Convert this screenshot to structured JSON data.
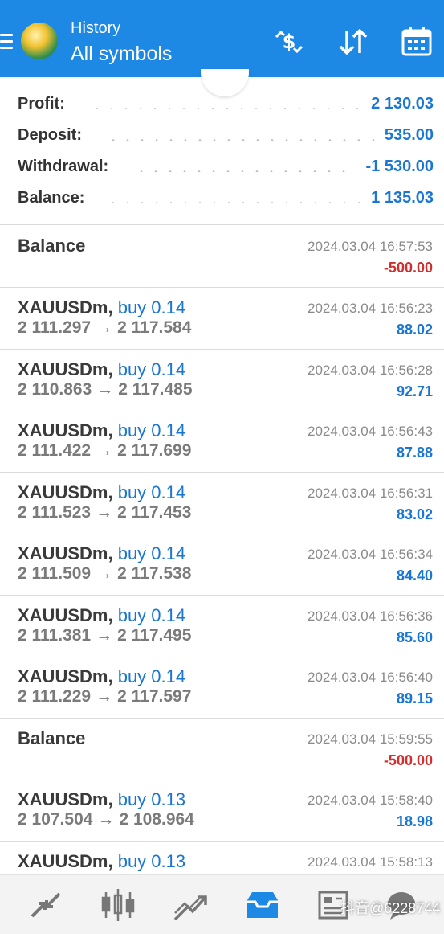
{
  "header": {
    "subtitle": "History",
    "title": "All symbols",
    "buttons": [
      "currency-switch-icon",
      "sort-icon",
      "calendar-icon"
    ]
  },
  "summary": {
    "profit": {
      "label": "Profit:",
      "value": "2 130.03"
    },
    "deposit": {
      "label": "Deposit:",
      "value": "535.00"
    },
    "withdrawal": {
      "label": "Withdrawal:",
      "value": "-1 530.00"
    },
    "balance": {
      "label": "Balance:",
      "value": "1 135.03"
    }
  },
  "deals": [
    {
      "kind": "balance",
      "title": "Balance",
      "time": "2024.03.04 16:57:53",
      "profit": "-500.00"
    },
    {
      "kind": "trade",
      "symbol": "XAUUSDm,",
      "side": "buy 0.14",
      "open": "2 111.297",
      "close": "2 117.584",
      "time": "2024.03.04 16:56:23",
      "profit": "88.02"
    },
    {
      "kind": "trade",
      "symbol": "XAUUSDm,",
      "side": "buy 0.14",
      "open": "2 110.863",
      "close": "2 117.485",
      "time": "2024.03.04 16:56:28",
      "profit": "92.71"
    },
    {
      "kind": "trade",
      "symbol": "XAUUSDm,",
      "side": "buy 0.14",
      "open": "2 111.422",
      "close": "2 117.699",
      "time": "2024.03.04 16:56:43",
      "profit": "87.88"
    },
    {
      "kind": "trade",
      "symbol": "XAUUSDm,",
      "side": "buy 0.14",
      "open": "2 111.523",
      "close": "2 117.453",
      "time": "2024.03.04 16:56:31",
      "profit": "83.02"
    },
    {
      "kind": "trade",
      "symbol": "XAUUSDm,",
      "side": "buy 0.14",
      "open": "2 111.509",
      "close": "2 117.538",
      "time": "2024.03.04 16:56:34",
      "profit": "84.40"
    },
    {
      "kind": "trade",
      "symbol": "XAUUSDm,",
      "side": "buy 0.14",
      "open": "2 111.381",
      "close": "2 117.495",
      "time": "2024.03.04 16:56:36",
      "profit": "85.60"
    },
    {
      "kind": "trade",
      "symbol": "XAUUSDm,",
      "side": "buy 0.14",
      "open": "2 111.229",
      "close": "2 117.597",
      "time": "2024.03.04 16:56:40",
      "profit": "89.15"
    },
    {
      "kind": "balance",
      "title": "Balance",
      "time": "2024.03.04 15:59:55",
      "profit": "-500.00"
    },
    {
      "kind": "trade",
      "symbol": "XAUUSDm,",
      "side": "buy 0.13",
      "open": "2 107.504",
      "close": "2 108.964",
      "time": "2024.03.04 15:58:40",
      "profit": "18.98"
    },
    {
      "kind": "trade",
      "symbol": "XAUUSDm,",
      "side": "buy 0.13",
      "open": "",
      "close": "",
      "time": "2024.03.04 15:58:13",
      "profit": ""
    }
  ],
  "price_arrow": "→",
  "bottom_nav": {
    "items": [
      "quotes-icon",
      "chart-icon",
      "trade-icon",
      "history-icon",
      "news-icon",
      "chat-icon"
    ],
    "active": "history-icon"
  },
  "watermark": "抖音@6228744",
  "colors": {
    "accent": "#1e88e5",
    "profit": "#1976d2",
    "loss": "#d32f2f"
  }
}
